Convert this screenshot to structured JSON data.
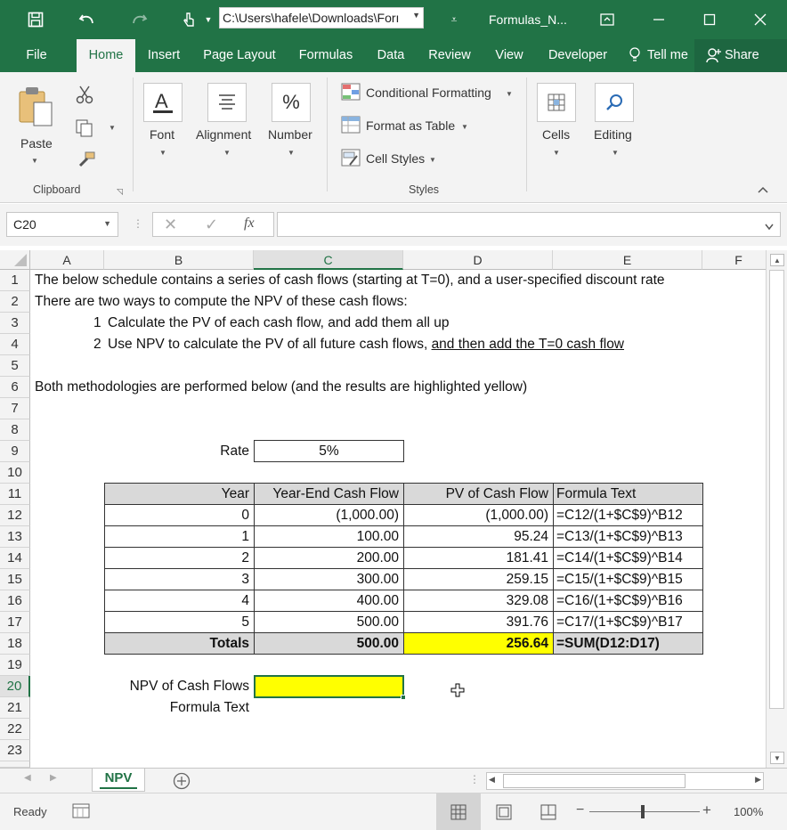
{
  "titlebar": {
    "path": "C:\\Users\\hafele\\Downloads\\Forı",
    "title": "Formulas_N..."
  },
  "tabs": [
    "File",
    "Home",
    "Insert",
    "Page Layout",
    "Formulas",
    "Data",
    "Review",
    "View",
    "Developer"
  ],
  "tell_me": "Tell me",
  "share": "Share",
  "ribbon": {
    "paste": "Paste",
    "clipboard": "Clipboard",
    "font": "Font",
    "alignment": "Alignment",
    "number": "Number",
    "conditional_formatting": "Conditional Formatting",
    "format_as_table": "Format as Table",
    "cell_styles": "Cell Styles",
    "styles": "Styles",
    "cells": "Cells",
    "editing": "Editing"
  },
  "formula_bar": {
    "name_box": "C20",
    "fx": "fx",
    "formula": ""
  },
  "columns": [
    "A",
    "B",
    "C",
    "D",
    "E",
    "F"
  ],
  "rows": [
    "1",
    "2",
    "3",
    "4",
    "5",
    "6",
    "7",
    "8",
    "9",
    "10",
    "11",
    "12",
    "13",
    "14",
    "15",
    "16",
    "17",
    "18",
    "19",
    "20",
    "21",
    "22",
    "23"
  ],
  "content": {
    "r1": "The below schedule contains a series of cash flows (starting at T=0), and a user-specified discount rate",
    "r2": "There are two ways to compute the NPV of these cash flows:",
    "r3_num": "1",
    "r3_text": "Calculate the PV of each cash flow, and add them all up",
    "r4_num": "2",
    "r4_text": "Use NPV to calculate the PV of all future cash flows, ",
    "r4_underlined": "and then add the T=0 cash flow",
    "r6": "Both methodologies are performed below (and the results are highlighted yellow)",
    "rate_label": "Rate",
    "rate_value": "5%",
    "npv_label": "NPV of Cash Flows",
    "formula_text_label": "Formula Text"
  },
  "table": {
    "headers": [
      "Year",
      "Year-End Cash Flow",
      "PV of Cash Flow",
      "Formula Text"
    ],
    "rows": [
      [
        "0",
        "(1,000.00)",
        "(1,000.00)",
        "=C12/(1+$C$9)^B12"
      ],
      [
        "1",
        "100.00",
        "95.24",
        "=C13/(1+$C$9)^B13"
      ],
      [
        "2",
        "200.00",
        "181.41",
        "=C14/(1+$C$9)^B14"
      ],
      [
        "3",
        "300.00",
        "259.15",
        "=C15/(1+$C$9)^B15"
      ],
      [
        "4",
        "400.00",
        "329.08",
        "=C16/(1+$C$9)^B16"
      ],
      [
        "5",
        "500.00",
        "391.76",
        "=C17/(1+$C$9)^B17"
      ]
    ],
    "totals": [
      "Totals",
      "500.00",
      "256.64",
      "=SUM(D12:D17)"
    ]
  },
  "sheet_tab": "NPV",
  "status": {
    "ready": "Ready",
    "zoom": "100%"
  },
  "colors": {
    "accent": "#217346",
    "highlight": "#ffff00",
    "table_header_bg": "#d9d9d9"
  }
}
